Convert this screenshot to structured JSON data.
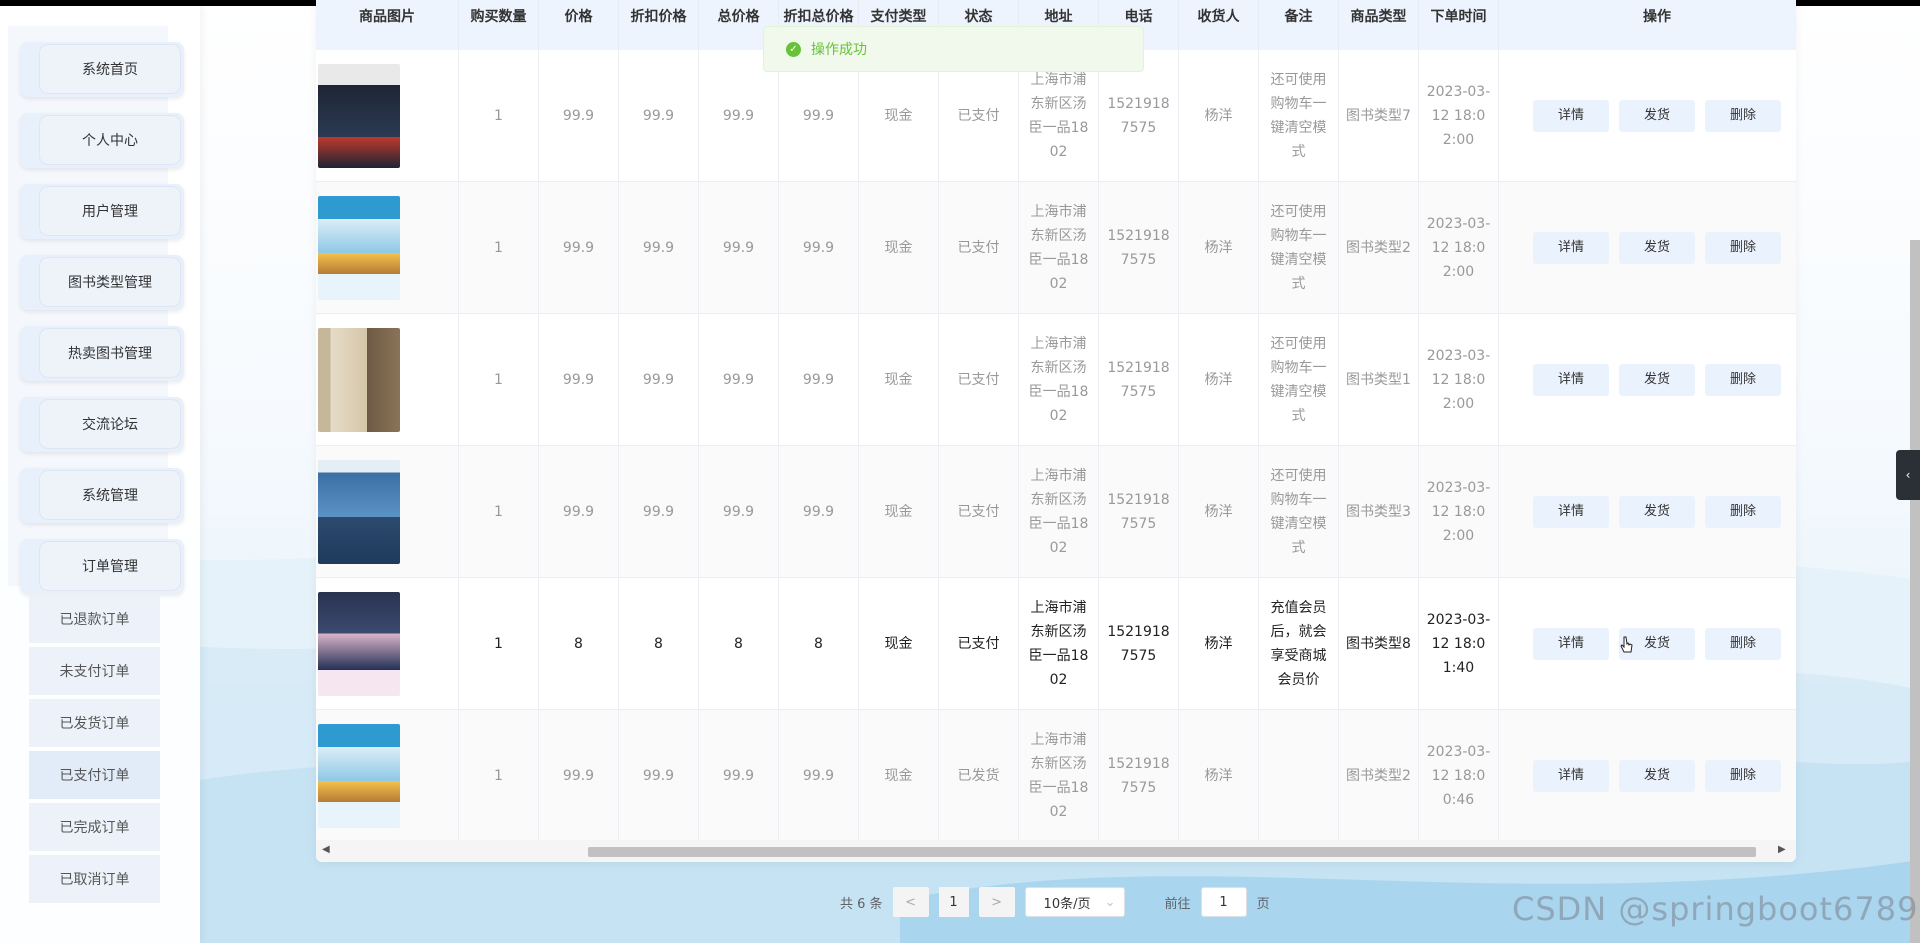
{
  "sidebar": {
    "menu": [
      "系统首页",
      "个人中心",
      "用户管理",
      "图书类型管理",
      "热卖图书管理",
      "交流论坛",
      "系统管理",
      "订单管理"
    ],
    "submenu": [
      "已退款订单",
      "未支付订单",
      "已发货订单",
      "已支付订单",
      "已完成订单",
      "已取消订单"
    ],
    "active_submenu": "已支付订单"
  },
  "toast": {
    "text": "操作成功",
    "icon": "check-circle-icon",
    "color": "#67c23a"
  },
  "table": {
    "headers": [
      "商品图片",
      "购买数量",
      "价格",
      "折扣价格",
      "总价格",
      "折扣总价格",
      "支付类型",
      "状态",
      "地址",
      "电话",
      "收货人",
      "备注",
      "商品类型",
      "下单时间",
      "操作"
    ],
    "actions": {
      "detail": "详情",
      "ship": "发货",
      "delete": "删除"
    },
    "rows": [
      {
        "cover": "book-cover-1",
        "qty": "1",
        "price": "99.9",
        "discount_price": "99.9",
        "total": "99.9",
        "discount_total": "99.9",
        "pay_type": "现金",
        "status": "已支付",
        "address": "上海市浦东新区汤臣一品1802",
        "phone": "15219187575",
        "receiver": "杨洋",
        "note": "还可使用购物车一键清空模式",
        "category": "图书类型7",
        "time": "2023-03-12 18:02:00"
      },
      {
        "cover": "book-cover-2",
        "qty": "1",
        "price": "99.9",
        "discount_price": "99.9",
        "total": "99.9",
        "discount_total": "99.9",
        "pay_type": "现金",
        "status": "已支付",
        "address": "上海市浦东新区汤臣一品1802",
        "phone": "15219187575",
        "receiver": "杨洋",
        "note": "还可使用购物车一键清空模式",
        "category": "图书类型2",
        "time": "2023-03-12 18:02:00"
      },
      {
        "cover": "book-cover-3",
        "qty": "1",
        "price": "99.9",
        "discount_price": "99.9",
        "total": "99.9",
        "discount_total": "99.9",
        "pay_type": "现金",
        "status": "已支付",
        "address": "上海市浦东新区汤臣一品1802",
        "phone": "15219187575",
        "receiver": "杨洋",
        "note": "还可使用购物车一键清空模式",
        "category": "图书类型1",
        "time": "2023-03-12 18:02:00"
      },
      {
        "cover": "book-cover-4",
        "qty": "1",
        "price": "99.9",
        "discount_price": "99.9",
        "total": "99.9",
        "discount_total": "99.9",
        "pay_type": "现金",
        "status": "已支付",
        "address": "上海市浦东新区汤臣一品1802",
        "phone": "15219187575",
        "receiver": "杨洋",
        "note": "还可使用购物车一键清空模式",
        "category": "图书类型3",
        "time": "2023-03-12 18:02:00"
      },
      {
        "cover": "book-cover-5",
        "qty": "1",
        "price": "8",
        "discount_price": "8",
        "total": "8",
        "discount_total": "8",
        "pay_type": "现金",
        "status": "已支付",
        "address": "上海市浦东新区汤臣一品1802",
        "phone": "15219187575",
        "receiver": "杨洋",
        "note": "充值会员后，就会享受商城会员价",
        "category": "图书类型8",
        "time": "2023-03-12 18:01:40"
      },
      {
        "cover": "book-cover-2",
        "qty": "1",
        "price": "99.9",
        "discount_price": "99.9",
        "total": "99.9",
        "discount_total": "99.9",
        "pay_type": "现金",
        "status": "已发货",
        "address": "上海市浦东新区汤臣一品1802",
        "phone": "15219187575",
        "receiver": "杨洋",
        "note": "",
        "category": "图书类型2",
        "time": "2023-03-12 18:00:46"
      }
    ]
  },
  "pagination": {
    "total_text": "共 6 条",
    "prev": "<",
    "next": ">",
    "page": "1",
    "page_size": "10条/页",
    "goto_prefix": "前往",
    "goto_value": "1",
    "goto_suffix": "页"
  },
  "watermark": "CSDN @springboot6789",
  "colors": {
    "accent": "#409eff",
    "header_bg": "#edf4fd",
    "button_bg": "#eaf2fd"
  }
}
